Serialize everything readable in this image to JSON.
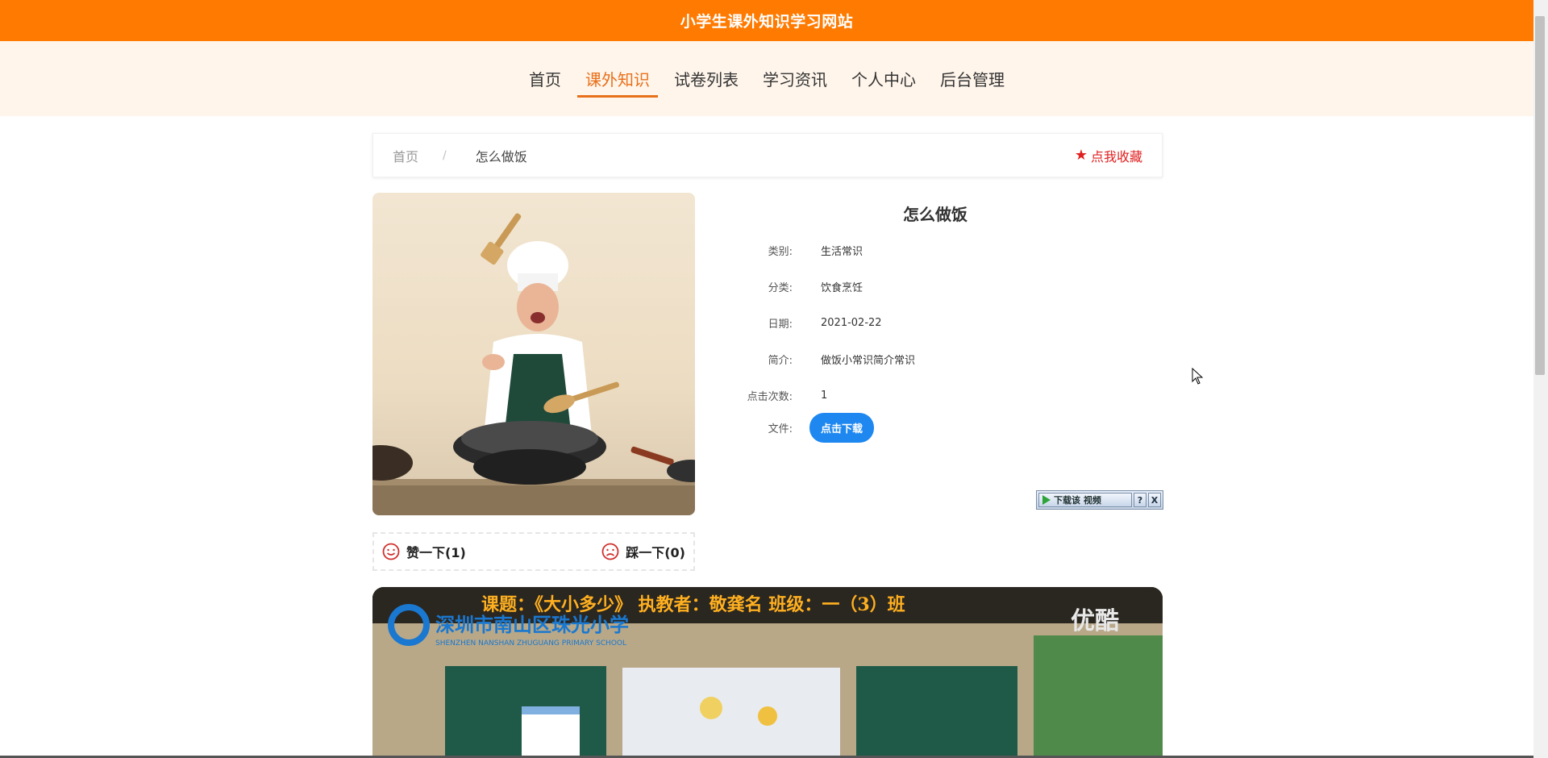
{
  "site": {
    "title": "小学生课外知识学习网站"
  },
  "nav": {
    "items": [
      {
        "label": "首页"
      },
      {
        "label": "课外知识",
        "active": true
      },
      {
        "label": "试卷列表"
      },
      {
        "label": "学习资讯"
      },
      {
        "label": "个人中心"
      },
      {
        "label": "后台管理"
      }
    ]
  },
  "breadcrumb": {
    "home": "首页",
    "separator": "/",
    "current": "怎么做饭",
    "favorite_label": "点我收藏"
  },
  "detail": {
    "title": "怎么做饭",
    "fields": [
      {
        "label": "类别:",
        "value": "生活常识"
      },
      {
        "label": "分类:",
        "value": "饮食烹饪"
      },
      {
        "label": "日期:",
        "value": "2021-02-22"
      },
      {
        "label": "简介:",
        "value": "做饭小常识简介常识"
      },
      {
        "label": "点击次数:",
        "value": "1"
      }
    ],
    "file_label": "文件:",
    "download_label": "点击下载"
  },
  "votes": {
    "like_label": "赞一下(1)",
    "dislike_label": "踩一下(0)"
  },
  "video_toolbar": {
    "download_label": "下载该 视频",
    "help_label": "?",
    "close_label": "X"
  },
  "video": {
    "banner": "课题：《大小多少》 执教者：敬龚名 班级：一（3）班",
    "school_cn": "深圳市南山区珠光小学",
    "school_en": "SHENZHEN NANSHAN ZHUGUANG PRIMARY SCHOOL",
    "watermark": "优酷"
  },
  "colors": {
    "brand": "#ff7a00",
    "nav_active": "#e8701a",
    "favorite": "#e02020",
    "button": "#1e88f0"
  }
}
